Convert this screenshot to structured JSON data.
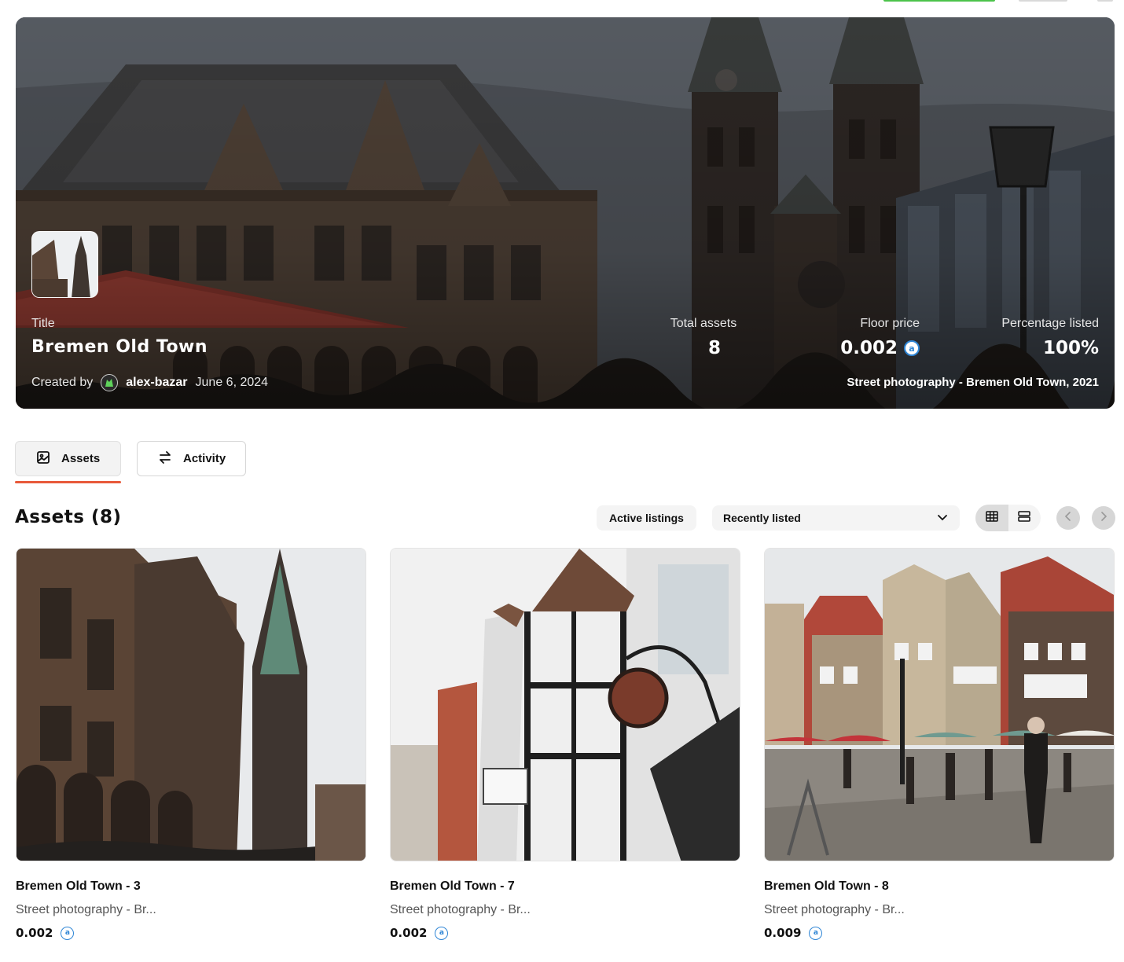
{
  "hero": {
    "title_label": "Title",
    "title": "Bremen Old Town",
    "created_by_label": "Created by",
    "creator_name": "alex-bazar",
    "created_date": "June 6, 2024",
    "caption": "Street photography - Bremen Old Town, 2021",
    "stats": {
      "total_assets_label": "Total assets",
      "total_assets": "8",
      "floor_price_label": "Floor price",
      "floor_price": "0.002",
      "percentage_listed_label": "Percentage listed",
      "percentage_listed": "100%"
    },
    "currency_icon": "a"
  },
  "tabs": [
    {
      "label": "Assets",
      "icon": "image-icon",
      "active": true
    },
    {
      "label": "Activity",
      "icon": "swap-arrows-icon",
      "active": false
    }
  ],
  "assets_section": {
    "heading": "Assets (8)",
    "filter_label": "Active listings",
    "sort_selected": "Recently listed",
    "view_modes": [
      "grid-view-icon",
      "list-view-icon"
    ]
  },
  "assets": [
    {
      "title": "Bremen Old Town - 3",
      "subtitle": "Street photography - Br...",
      "price": "0.002"
    },
    {
      "title": "Bremen Old Town - 7",
      "subtitle": "Street photography - Br...",
      "price": "0.002"
    },
    {
      "title": "Bremen Old Town - 8",
      "subtitle": "Street photography - Br...",
      "price": "0.009"
    }
  ]
}
